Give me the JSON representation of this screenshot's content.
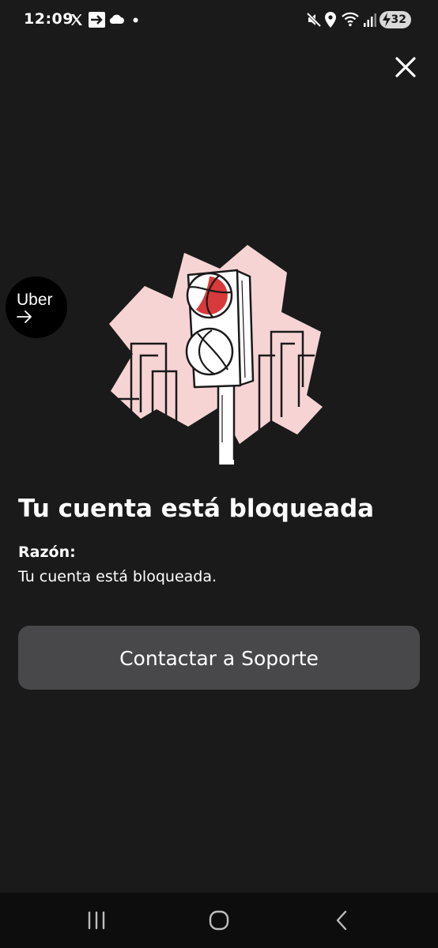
{
  "status_bar": {
    "time": "12:09",
    "battery_level": "32",
    "notification_icons": [
      "x-app-icon",
      "forward-message-icon",
      "cloud-icon",
      "dot-icon"
    ],
    "system_icons": [
      "mute-icon",
      "location-icon",
      "wifi-icon",
      "signal-icon",
      "battery-charging-icon"
    ]
  },
  "uber_bubble": {
    "label": "Uber"
  },
  "content": {
    "title": "Tu cuenta está bloqueada",
    "reason_label": "Razón:",
    "reason_text": "Tu cuenta está bloqueada.",
    "support_button_label": "Contactar a Soporte"
  },
  "colors": {
    "background": "#1a1a1a",
    "button_background": "#48484a",
    "illustration_pink": "#f7d4d4",
    "traffic_light_red": "#d8393a"
  },
  "nav_bar": {
    "buttons": [
      "recent-apps-icon",
      "home-icon",
      "back-icon"
    ]
  }
}
